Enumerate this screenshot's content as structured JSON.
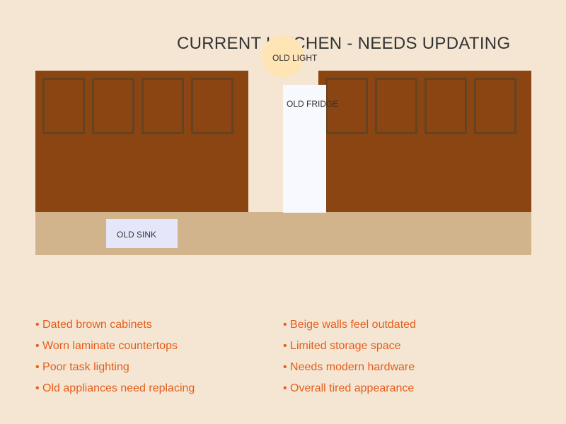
{
  "title": "CURRENT KITCHEN - NEEDS UPDATING",
  "labels": {
    "light": "OLD LIGHT",
    "fridge": "OLD FRIDGE",
    "sink": "OLD SINK"
  },
  "colors": {
    "background": "#f5e6d3",
    "cabinet": "#8b4513",
    "cabinet_door_border": "#654321",
    "counter": "#d2b48c",
    "fridge": "#f8f8ff",
    "sink": "#e6e6fa",
    "light": "#ffe4b5",
    "note_text": "#e65c1a"
  },
  "issues_left": [
    "• Dated brown cabinets",
    "• Worn laminate countertops",
    "• Poor task lighting",
    "• Old appliances need replacing"
  ],
  "issues_right": [
    "• Beige walls feel outdated",
    "• Limited storage space",
    "• Needs modern hardware",
    "• Overall tired appearance"
  ]
}
